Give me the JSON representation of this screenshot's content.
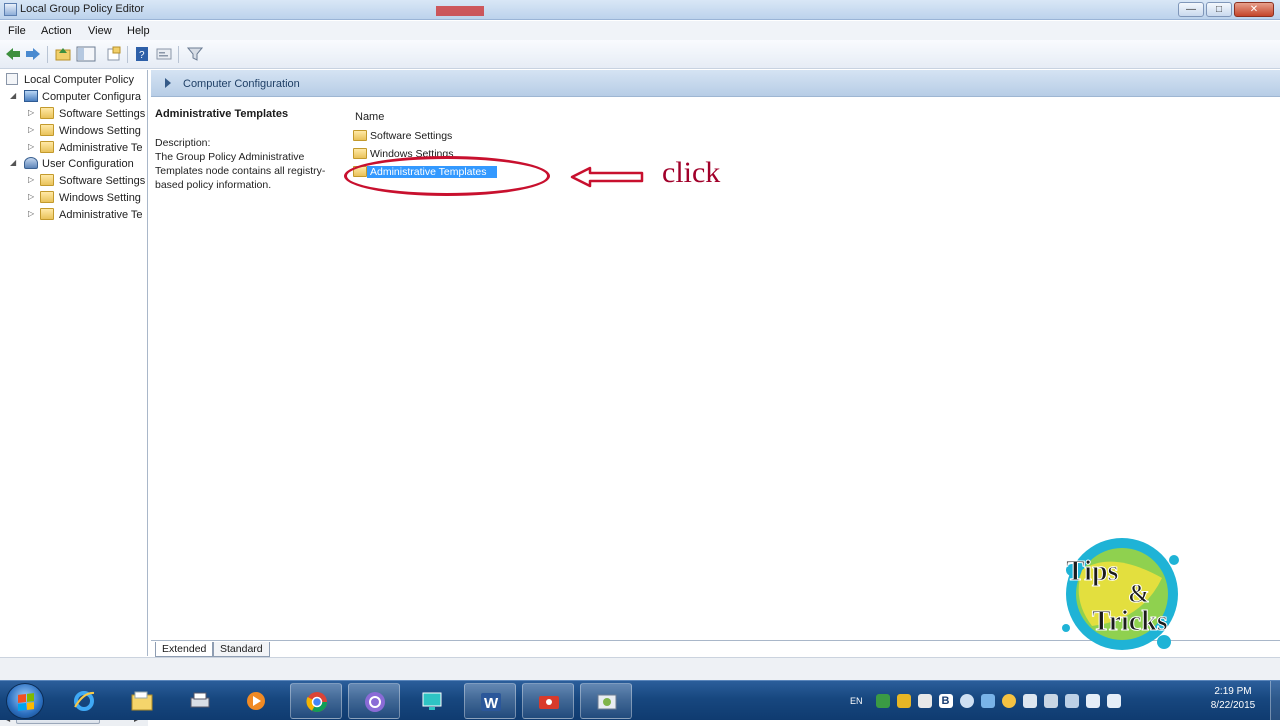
{
  "window": {
    "title": "Local Group Policy Editor",
    "controls": {
      "minimize": "—",
      "maximize": "□",
      "close": "✕"
    }
  },
  "menu": [
    "File",
    "Action",
    "View",
    "Help"
  ],
  "toolbar": {
    "icons": [
      "back-icon",
      "forward-icon",
      "up-folder-icon",
      "show-hide-tree-icon",
      "export-list-icon",
      "help-icon",
      "properties-icon",
      "filter-icon"
    ]
  },
  "tree": {
    "root": "Local Computer Policy",
    "computer": {
      "label": "Computer Configura",
      "children": [
        "Software Settings",
        "Windows Setting",
        "Administrative Te"
      ]
    },
    "user": {
      "label": "User Configuration",
      "children": [
        "Software Settings",
        "Windows Setting",
        "Administrative Te"
      ]
    }
  },
  "breadcrumb": "Computer Configuration",
  "description": {
    "title": "Administrative Templates",
    "label": "Description:",
    "text": "The Group Policy Administrative Templates node contains all registry-based policy information."
  },
  "list": {
    "column": "Name",
    "items": [
      {
        "label": "Software Settings",
        "selected": false
      },
      {
        "label": "Windows Settings",
        "selected": false
      },
      {
        "label": "Administrative Templates",
        "selected": true
      }
    ]
  },
  "tabs": [
    "Extended",
    "Standard"
  ],
  "active_tab": "Extended",
  "annotation": {
    "text": "click",
    "color": "#c8102e"
  },
  "logo": {
    "line1": "Tips",
    "amp": "&",
    "line2": "Tricks"
  },
  "taskbar": {
    "language": "EN",
    "time": "2:19 PM",
    "date": "8/22/2015",
    "apps": [
      "internet-explorer-icon",
      "file-explorer-icon",
      "printer-icon",
      "media-player-icon",
      "chrome-icon",
      "browser-e-icon",
      "remote-desktop-icon",
      "word-icon",
      "screen-recorder-icon",
      "group-policy-icon"
    ]
  },
  "colors": {
    "selection": "#3399ff",
    "annotation": "#c8102e",
    "taskbar": "#17477f"
  }
}
